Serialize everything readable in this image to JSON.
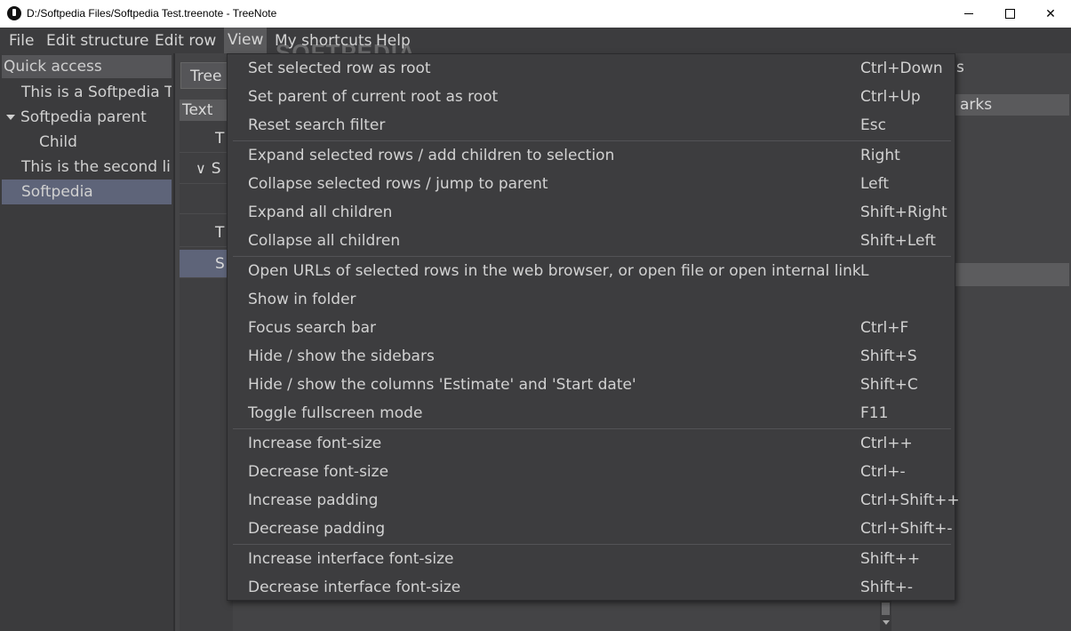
{
  "window": {
    "title": "D:/Softpedia Files/Softpedia Test.treenote - TreeNote",
    "minimize": "—",
    "maximize": "☐",
    "close": "✕"
  },
  "menubar": [
    {
      "label": "File",
      "active": false
    },
    {
      "label": "Edit structure",
      "active": false
    },
    {
      "label": "Edit row",
      "active": false
    },
    {
      "label": "View",
      "active": true
    },
    {
      "label": "My shortcuts",
      "active": false
    },
    {
      "label": "Help",
      "active": false
    }
  ],
  "watermark": "SOFTPEDIA",
  "sidebar": {
    "header": "Quick access",
    "items": [
      {
        "label": "This is a Softpedia Test",
        "level": 0,
        "expanded": null,
        "selected": false
      },
      {
        "label": "Softpedia parent",
        "level": 0,
        "expanded": true,
        "selected": false
      },
      {
        "label": "Child",
        "level": 1,
        "expanded": null,
        "selected": false
      },
      {
        "label": "This is the second line",
        "level": 0,
        "expanded": null,
        "selected": false
      },
      {
        "label": "Softpedia",
        "level": 0,
        "expanded": null,
        "selected": true
      }
    ]
  },
  "main": {
    "tab_label": "Tree",
    "column_header": "Text",
    "rows": [
      {
        "text": "T",
        "chevron": ""
      },
      {
        "text": "S",
        "chevron": "∨"
      },
      {
        "text": "",
        "chevron": ""
      },
      {
        "text": "T",
        "chevron": ""
      },
      {
        "text": "S",
        "chevron": ""
      }
    ],
    "right_panel_label": "s",
    "bookmarks_header": "arks"
  },
  "view_menu": {
    "groups": [
      [
        {
          "label": "Set selected row as root",
          "shortcut": "Ctrl+Down"
        },
        {
          "label": "Set parent of current root as root",
          "shortcut": "Ctrl+Up"
        },
        {
          "label": "Reset search filter",
          "shortcut": "Esc"
        }
      ],
      [
        {
          "label": "Expand selected rows / add children to selection",
          "shortcut": "Right"
        },
        {
          "label": "Collapse selected rows / jump to parent",
          "shortcut": "Left"
        },
        {
          "label": "Expand all children",
          "shortcut": "Shift+Right"
        },
        {
          "label": "Collapse all children",
          "shortcut": "Shift+Left"
        }
      ],
      [
        {
          "label": "Open URLs of selected rows in the web browser, or open file or open internal link",
          "shortcut": "L"
        },
        {
          "label": "Show in folder",
          "shortcut": ""
        },
        {
          "label": "Focus search bar",
          "shortcut": "Ctrl+F"
        },
        {
          "label": "Hide / show the sidebars",
          "shortcut": "Shift+S"
        },
        {
          "label": "Hide / show the columns 'Estimate' and 'Start date'",
          "shortcut": "Shift+C"
        },
        {
          "label": "Toggle fullscreen mode",
          "shortcut": "F11"
        }
      ],
      [
        {
          "label": "Increase font-size",
          "shortcut": "Ctrl++"
        },
        {
          "label": "Decrease font-size",
          "shortcut": "Ctrl+-"
        },
        {
          "label": "Increase padding",
          "shortcut": "Ctrl+Shift++"
        },
        {
          "label": "Decrease padding",
          "shortcut": "Ctrl+Shift+-"
        }
      ],
      [
        {
          "label": "Increase interface font-size",
          "shortcut": "Shift++"
        },
        {
          "label": "Decrease interface font-size",
          "shortcut": "Shift+-"
        }
      ]
    ]
  },
  "colors": {
    "background": "#444446",
    "menu_bg": "#3d3d3f",
    "selection": "#5e6479",
    "text": "#d2d2d2"
  }
}
